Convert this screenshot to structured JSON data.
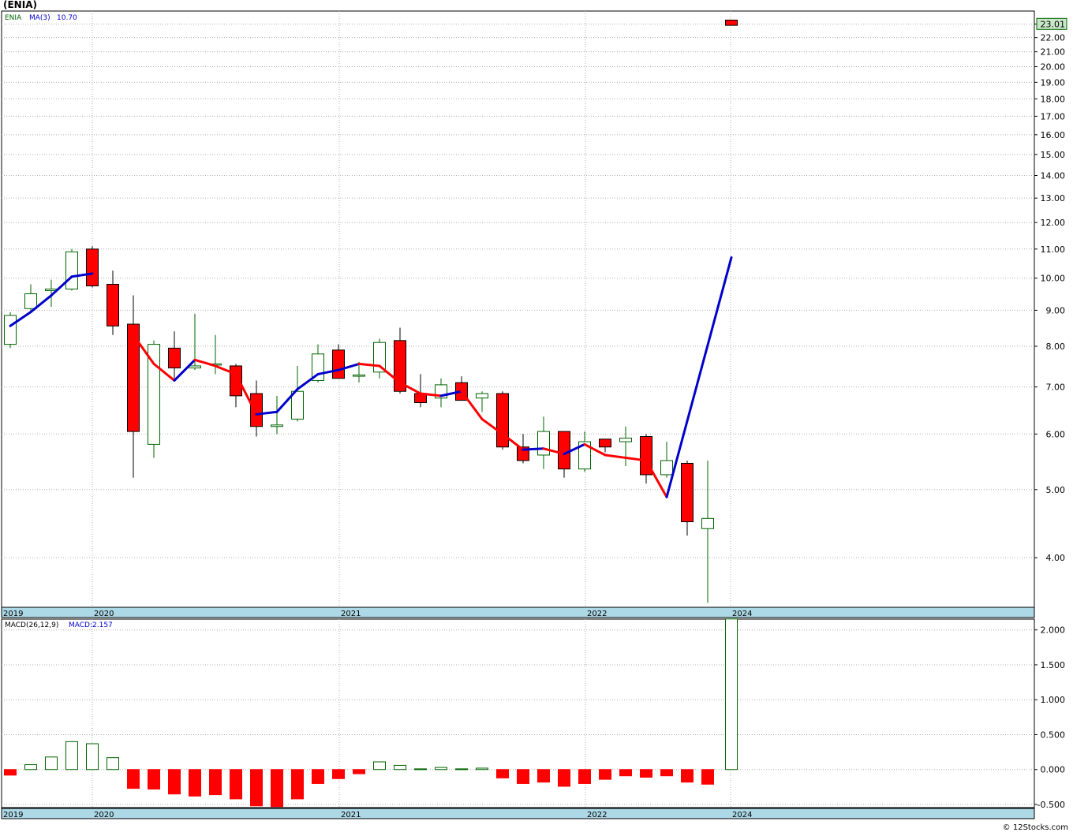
{
  "chart_data": [
    {
      "type": "candlestick",
      "title": "(ENIA)",
      "ticker": "ENIA",
      "indicator": {
        "label": "MA(3)",
        "value": "10.70"
      },
      "last_price": "23.01",
      "y_scale": "log",
      "ylim": [
        3.4,
        24.0
      ],
      "x_ticks": [
        "2019",
        "2020",
        "2021",
        "2022",
        "2024"
      ],
      "y_ticks": [
        "4.00",
        "5.00",
        "6.00",
        "7.00",
        "8.00",
        "9.00",
        "10.00",
        "11.00",
        "12.00",
        "13.00",
        "14.00",
        "15.00",
        "16.00",
        "17.00",
        "18.00",
        "19.00",
        "20.00",
        "21.00",
        "22.00",
        "23.00"
      ],
      "candles": [
        {
          "o": 8.05,
          "h": 8.95,
          "l": 7.95,
          "c": 8.85
        },
        {
          "o": 9.05,
          "h": 9.8,
          "l": 9.0,
          "c": 9.5
        },
        {
          "o": 9.6,
          "h": 9.95,
          "l": 9.1,
          "c": 9.65
        },
        {
          "o": 9.65,
          "h": 11.0,
          "l": 9.6,
          "c": 10.9
        },
        {
          "o": 11.0,
          "h": 11.1,
          "l": 9.7,
          "c": 9.75
        },
        {
          "o": 9.8,
          "h": 10.25,
          "l": 8.3,
          "c": 8.55
        },
        {
          "o": 8.6,
          "h": 9.45,
          "l": 5.2,
          "c": 6.05
        },
        {
          "o": 5.8,
          "h": 8.15,
          "l": 5.55,
          "c": 8.05
        },
        {
          "o": 7.95,
          "h": 8.4,
          "l": 7.2,
          "c": 7.45
        },
        {
          "o": 7.45,
          "h": 8.9,
          "l": 7.4,
          "c": 7.5
        },
        {
          "o": 7.52,
          "h": 8.3,
          "l": 7.3,
          "c": 7.55
        },
        {
          "o": 7.5,
          "h": 7.55,
          "l": 6.55,
          "c": 6.8
        },
        {
          "o": 6.85,
          "h": 7.15,
          "l": 5.95,
          "c": 6.15
        },
        {
          "o": 6.15,
          "h": 6.8,
          "l": 6.0,
          "c": 6.18
        },
        {
          "o": 6.3,
          "h": 7.5,
          "l": 6.25,
          "c": 6.9
        },
        {
          "o": 7.15,
          "h": 8.05,
          "l": 7.1,
          "c": 7.8
        },
        {
          "o": 7.9,
          "h": 8.05,
          "l": 7.2,
          "c": 7.2
        },
        {
          "o": 7.25,
          "h": 7.6,
          "l": 7.1,
          "c": 7.28
        },
        {
          "o": 7.35,
          "h": 8.2,
          "l": 7.2,
          "c": 8.1
        },
        {
          "o": 8.15,
          "h": 8.5,
          "l": 6.85,
          "c": 6.9
        },
        {
          "o": 6.85,
          "h": 7.3,
          "l": 6.55,
          "c": 6.65
        },
        {
          "o": 6.75,
          "h": 7.2,
          "l": 6.55,
          "c": 7.05
        },
        {
          "o": 7.1,
          "h": 7.25,
          "l": 6.7,
          "c": 6.7
        },
        {
          "o": 6.75,
          "h": 6.9,
          "l": 6.45,
          "c": 6.85
        },
        {
          "o": 6.85,
          "h": 6.9,
          "l": 5.7,
          "c": 5.75
        },
        {
          "o": 5.75,
          "h": 6.0,
          "l": 5.45,
          "c": 5.5
        },
        {
          "o": 5.6,
          "h": 6.35,
          "l": 5.35,
          "c": 6.05
        },
        {
          "o": 6.05,
          "h": 6.05,
          "l": 5.2,
          "c": 5.35
        },
        {
          "o": 5.35,
          "h": 6.05,
          "l": 5.3,
          "c": 5.85
        },
        {
          "o": 5.9,
          "h": 5.9,
          "l": 5.65,
          "c": 5.75
        },
        {
          "o": 5.85,
          "h": 6.15,
          "l": 5.4,
          "c": 5.92
        },
        {
          "o": 5.95,
          "h": 6.0,
          "l": 5.1,
          "c": 5.25
        },
        {
          "o": 5.25,
          "h": 5.85,
          "l": 5.2,
          "c": 5.5
        },
        {
          "o": 5.45,
          "h": 5.5,
          "l": 4.3,
          "c": 4.5
        },
        {
          "o": 4.4,
          "h": 5.5,
          "l": 3.45,
          "c": 4.55
        },
        {
          "o": 23.3,
          "h": 23.3,
          "l": 22.9,
          "c": 22.9
        }
      ],
      "ma3": [
        8.55,
        8.95,
        9.45,
        10.05,
        10.15,
        null,
        8.3,
        7.55,
        7.15,
        7.65,
        7.5,
        7.3,
        6.4,
        6.45,
        6.95,
        7.3,
        7.4,
        7.55,
        7.5,
        7.1,
        6.85,
        6.8,
        6.9,
        6.3,
        6.0,
        5.7,
        5.72,
        5.62,
        5.8,
        5.6,
        5.55,
        5.5,
        4.88,
        10.7
      ],
      "colors": {
        "up": "#ffffff",
        "up_border": "#006400",
        "down": "#ff0000",
        "ma_up": "#0000cc",
        "ma_down": "#ff0000",
        "axis_band": "#add8e6",
        "last_price_bg": "#c8e6c8"
      }
    },
    {
      "type": "bar",
      "title": "MACD(26,12,9)",
      "indicator": {
        "label": "MACD",
        "value": "2.157"
      },
      "ylim": [
        -0.5,
        2.2
      ],
      "x_ticks": [
        "2019",
        "2020",
        "2021",
        "2022",
        "2024"
      ],
      "y_ticks": [
        "-0.500",
        "0.000",
        "0.500",
        "1.000",
        "1.500",
        "2.000"
      ],
      "values": [
        -0.08,
        0.07,
        0.18,
        0.4,
        0.37,
        0.17,
        -0.27,
        -0.28,
        -0.35,
        -0.38,
        -0.36,
        -0.42,
        -0.52,
        -0.53,
        -0.42,
        -0.2,
        -0.13,
        -0.06,
        0.11,
        0.06,
        0.01,
        0.03,
        0.01,
        0.02,
        -0.12,
        -0.2,
        -0.18,
        -0.24,
        -0.2,
        -0.14,
        -0.09,
        -0.11,
        -0.09,
        -0.18,
        -0.21,
        2.157
      ],
      "colors": {
        "positive": "#ffffff",
        "positive_border": "#006400",
        "negative": "#ff0000"
      }
    }
  ],
  "footer": {
    "credit": "© 12Stocks.com"
  }
}
